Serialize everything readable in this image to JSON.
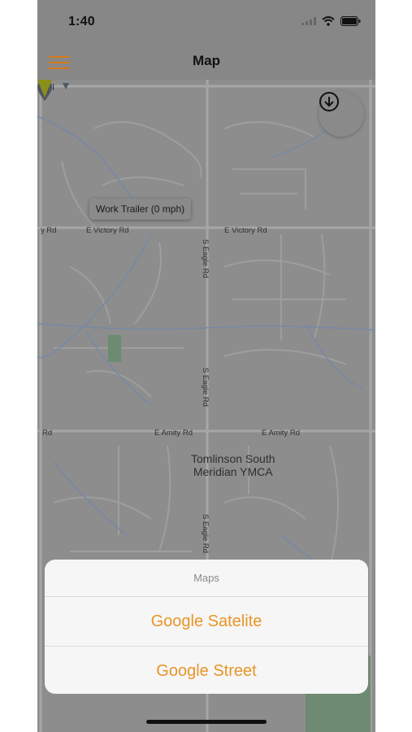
{
  "status_bar": {
    "time": "1:40"
  },
  "nav": {
    "title": "Map"
  },
  "map": {
    "labels": {
      "school_fragment": "ool",
      "victory_left_fragment": "y Rd",
      "e_victory_rd_left": "E Victory Rd",
      "e_victory_rd_right": "E Victory Rd",
      "s_eagle_rd_1": "S Eagle Rd",
      "s_eagle_rd_2": "S Eagle Rd",
      "s_eagle_rd_3": "S Eagle Rd",
      "amity_left_fragment": "Rd",
      "e_amity_rd_left": "E Amity Rd",
      "e_amity_rd_right": "E Amity Rd",
      "poi_line1": "Tomlinson South",
      "poi_line2": "Meridian YMCA"
    },
    "vehicle_tooltip": "Work Trailer (0 mph)"
  },
  "action_sheet": {
    "title": "Maps",
    "options": [
      "Google Satelite",
      "Google Street"
    ],
    "option_color": "#e89527"
  },
  "icons": {
    "menu": "hamburger-icon",
    "download": "download-circle-icon",
    "vehicle": "triangle-marker-icon",
    "poi": "location-pin-icon"
  }
}
